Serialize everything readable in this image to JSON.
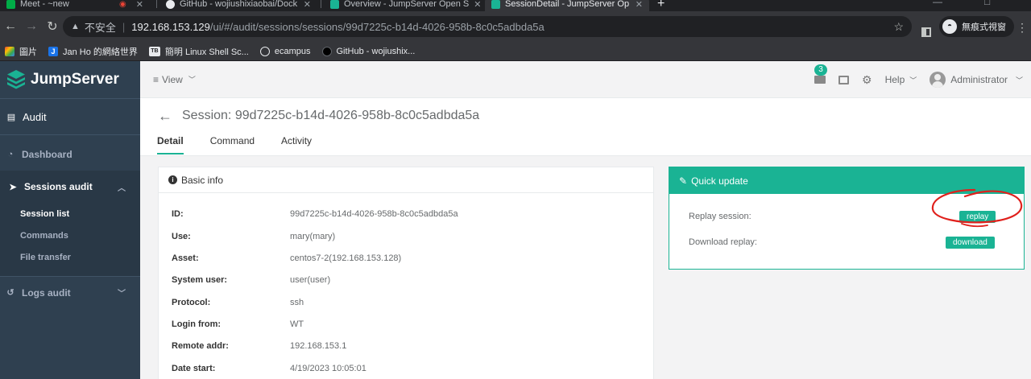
{
  "browser": {
    "tabs": [
      {
        "title": "Meet - ~new",
        "active": false
      },
      {
        "title": "GitHub - wojiushixiaobai/Dock",
        "active": false
      },
      {
        "title": "Overview - JumpServer Open S",
        "active": false
      },
      {
        "title": "SessionDetail - JumpServer Op",
        "active": true
      }
    ],
    "url_insecure_label": "不安全",
    "url_host": "192.168.153.129",
    "url_path": "/ui/#/audit/sessions/sessions/99d7225c-b14d-4026-958b-8c0c5adbda5a",
    "incognito_label": "無痕式視窗",
    "bookmarks": [
      {
        "label": "圖片",
        "icon": "image-icon"
      },
      {
        "label": "Jan Ho 的網絡世界",
        "icon": "J"
      },
      {
        "label": "簡明 Linux Shell Sc...",
        "icon": "TB"
      },
      {
        "label": "ecampus",
        "icon": "globe-icon"
      },
      {
        "label": "GitHub - wojiushix...",
        "icon": "github-icon"
      }
    ]
  },
  "sidebar": {
    "logo_text": "JumpServer",
    "section": "Audit",
    "items": [
      {
        "label": "Dashboard",
        "icon": "dashboard-icon"
      },
      {
        "label": "Sessions audit",
        "icon": "rocket-icon"
      },
      {
        "label": "Logs audit",
        "icon": "history-icon"
      }
    ],
    "sub_items": [
      "Session list",
      "Commands",
      "File transfer"
    ]
  },
  "topnav": {
    "view_label": "View",
    "mail_count": "3",
    "help_label": "Help",
    "user_name": "Administrator"
  },
  "page": {
    "title": "Session: 99d7225c-b14d-4026-958b-8c0c5adbda5a",
    "tabs": [
      "Detail",
      "Command",
      "Activity"
    ],
    "active_tab": "Detail"
  },
  "basic_info": {
    "title": "Basic info",
    "rows": [
      {
        "key": "ID:",
        "value": "99d7225c-b14d-4026-958b-8c0c5adbda5a"
      },
      {
        "key": "Use:",
        "value": "mary(mary)"
      },
      {
        "key": "Asset:",
        "value": "centos7-2(192.168.153.128)"
      },
      {
        "key": "System user:",
        "value": "user(user)"
      },
      {
        "key": "Protocol:",
        "value": "ssh"
      },
      {
        "key": "Login from:",
        "value": "WT"
      },
      {
        "key": "Remote addr:",
        "value": "192.168.153.1"
      },
      {
        "key": "Date start:",
        "value": "4/19/2023 10:05:01"
      }
    ]
  },
  "quick_update": {
    "title": "Quick update",
    "replay_label": "Replay session:",
    "replay_button": "replay",
    "download_label": "Download replay:",
    "download_button": "download"
  },
  "colors": {
    "accent": "#1ab394",
    "sidebar_bg": "#2f4050",
    "annotation": "#e0201c"
  }
}
